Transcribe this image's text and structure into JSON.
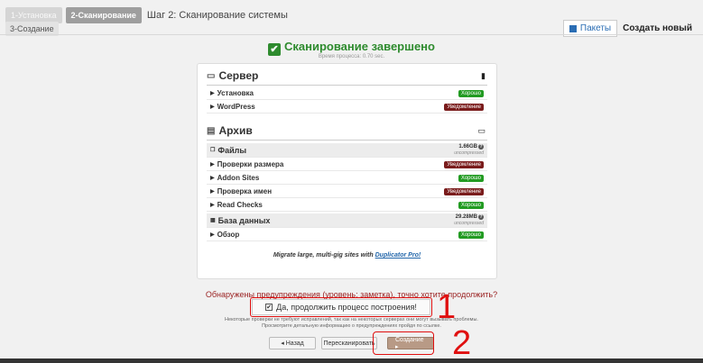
{
  "header": {
    "step1": "1-Установка",
    "step2": "2-Сканирование",
    "step_title": "Шаг 2: Сканирование системы",
    "step3": "3-Создание",
    "packages_btn": "Пакеты",
    "create_new": "Создать новый"
  },
  "scan": {
    "title": "Сканирование завершено",
    "time": "Время процесса: 0.70 sec."
  },
  "server": {
    "title": "Сервер",
    "rows": [
      {
        "label": "Установка",
        "status": "Хорошо",
        "kind": "ok"
      },
      {
        "label": "WordPress",
        "status": "Уведомление",
        "kind": "warn"
      }
    ]
  },
  "archive": {
    "title": "Архив",
    "files": {
      "label": "Файлы",
      "size": "1.66GB",
      "size_note": "uncompressed"
    },
    "file_rows": [
      {
        "label": "Проверки размера",
        "status": "Уведомление",
        "kind": "warn"
      },
      {
        "label": "Addon Sites",
        "status": "Хорошо",
        "kind": "ok"
      },
      {
        "label": "Проверка имен",
        "status": "Уведомление",
        "kind": "warn"
      },
      {
        "label": "Read Checks",
        "status": "Хорошо",
        "kind": "ok"
      }
    ],
    "db": {
      "label": "База данных",
      "size": "29.28MB",
      "size_note": "uncompressed"
    },
    "db_rows": [
      {
        "label": "Обзор",
        "status": "Хорошо",
        "kind": "ok"
      }
    ]
  },
  "promo": {
    "text": "Migrate large, multi-gig sites with",
    "link": "Duplicator Pro!"
  },
  "warning": {
    "question": "Обнаружены предупреждения (уровень: заметка), точно хотите продолжить?",
    "continue_label": "Да, продолжить процесс построения!",
    "note1": "Некоторые проверки не требуют исправлений, так как на некоторых серверах они могут вызывать проблемы.",
    "note2": "Просмотрите детальную информацию о предупреждениях пройдя по ссылке."
  },
  "buttons": {
    "back": "◂ Назад",
    "rescan": "Пересканировать",
    "create": "Создание ▸"
  },
  "annotations": {
    "n1": "1",
    "n2": "2"
  }
}
